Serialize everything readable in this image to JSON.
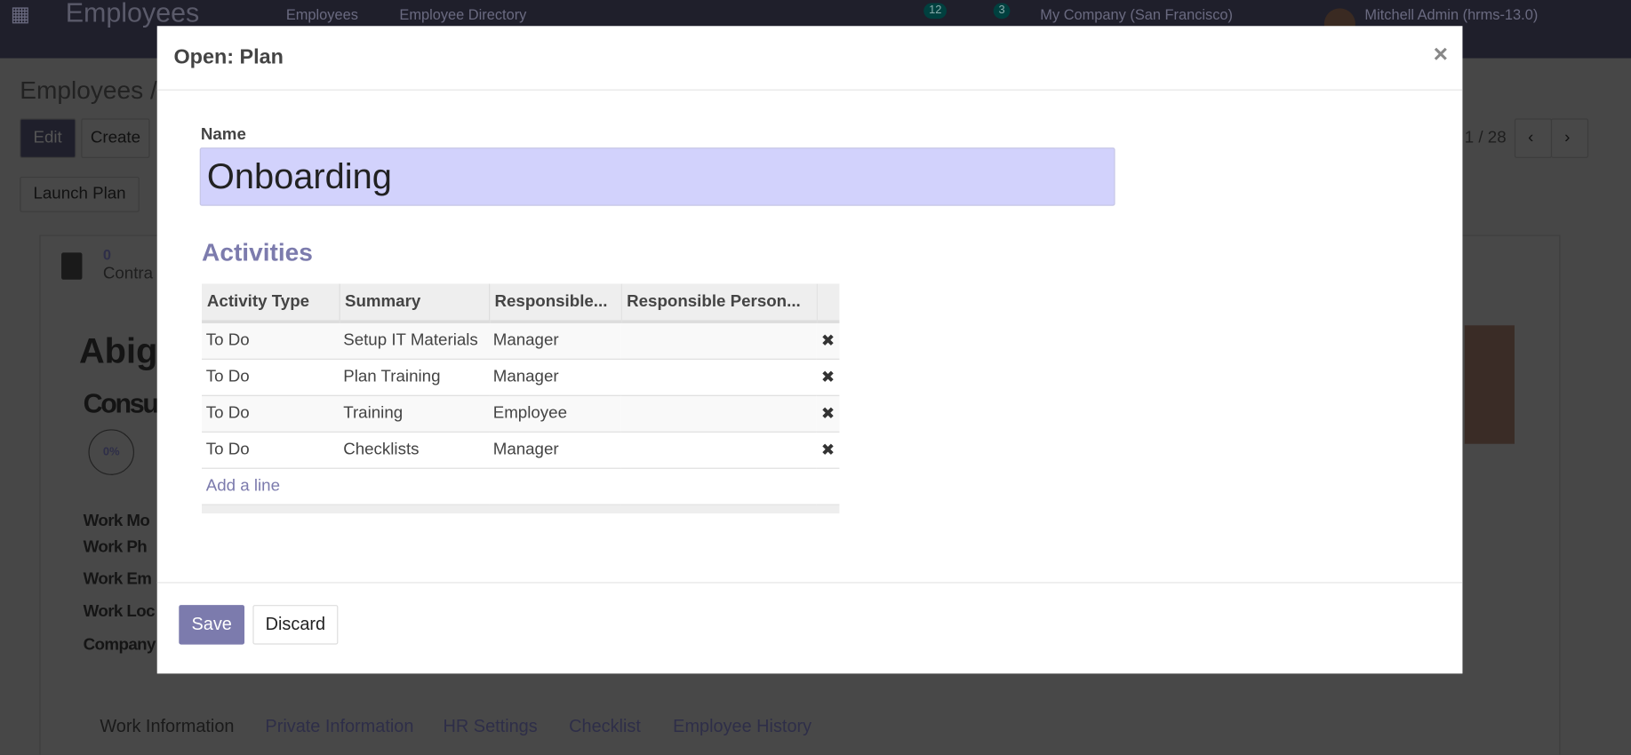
{
  "navbar": {
    "app_title": "Employees",
    "menu": [
      "Employees",
      "Employee Directory"
    ],
    "activity_badge": "12",
    "messages_badge": "3",
    "company": "My Company (San Francisco)",
    "user": "Mitchell Admin (hrms-13.0)"
  },
  "background": {
    "breadcrumb": "Employees /",
    "edit": "Edit",
    "create": "Create",
    "pager": "1 / 28",
    "launch_plan": "Launch Plan",
    "contracts_count": "0",
    "contracts_label": "Contra",
    "name_fragment": "Abig",
    "job_fragment": "Consu",
    "progress": "0%",
    "labels": [
      "Work Mo",
      "Work Ph",
      "Work Em",
      "Work Loc",
      "Company"
    ],
    "tabs": [
      "Work Information",
      "Private Information",
      "HR Settings",
      "Checklist",
      "Employee History"
    ]
  },
  "modal": {
    "title": "Open: Plan",
    "close": "×",
    "name_label": "Name",
    "name_value": "Onboarding",
    "activities_heading": "Activities",
    "columns": [
      "Activity Type",
      "Summary",
      "Responsible...",
      "Responsible Person..."
    ],
    "rows": [
      {
        "type": "To Do",
        "summary": "Setup IT Materials",
        "responsible": "Manager",
        "person": ""
      },
      {
        "type": "To Do",
        "summary": "Plan Training",
        "responsible": "Manager",
        "person": ""
      },
      {
        "type": "To Do",
        "summary": "Training",
        "responsible": "Employee",
        "person": ""
      },
      {
        "type": "To Do",
        "summary": "Checklists",
        "responsible": "Manager",
        "person": ""
      }
    ],
    "delete_icon": "✖",
    "add_line": "Add a line",
    "save": "Save",
    "discard": "Discard"
  },
  "colors": {
    "accent": "#7c7bad",
    "input_bg": "#d2d2fc"
  }
}
